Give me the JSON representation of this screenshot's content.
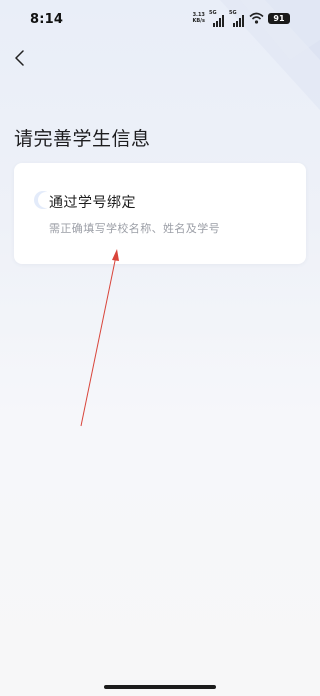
{
  "status_bar": {
    "time": "8:14",
    "net_speed_value": "3.13",
    "net_speed_unit": "KB/s",
    "signal_1_label": "5G",
    "signal_2_label": "5G",
    "battery": "91",
    "icons": [
      "signal-bars-icon",
      "signal-bars-icon",
      "wifi-icon",
      "battery-icon"
    ]
  },
  "header": {
    "back_icon": "chevron-left-icon"
  },
  "page": {
    "title": "请完善学生信息"
  },
  "bind_option": {
    "title": "通过学号绑定",
    "subtitle": "需正确填写学校名称、姓名及学号",
    "icon": "circle-icon"
  },
  "colors": {
    "annotation_arrow": "#d9453b",
    "battery_bg": "#1a1a1a"
  }
}
